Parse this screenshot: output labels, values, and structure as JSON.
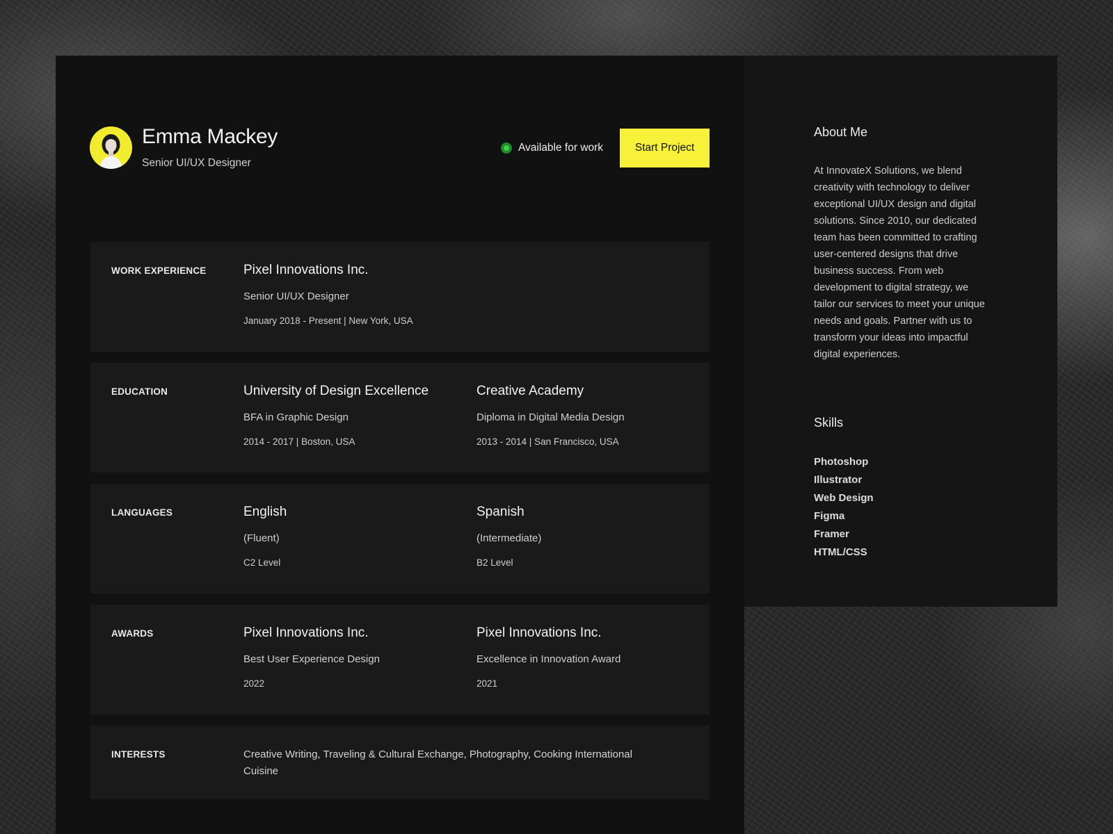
{
  "profile": {
    "name": "Emma Mackey",
    "role": "Senior UI/UX Designer",
    "status": "Available for work",
    "cta_label": "Start Project"
  },
  "sections": {
    "work": {
      "label": "WORK EXPERIENCE",
      "items": [
        {
          "title": "Pixel Innovations Inc.",
          "subtitle": "Senior UI/UX Designer",
          "meta": "January 2018 - Present | New York, USA"
        }
      ]
    },
    "education": {
      "label": "EDUCATION",
      "items": [
        {
          "title": "University of Design Excellence",
          "subtitle": "BFA in Graphic Design",
          "meta": "2014 - 2017 | Boston, USA"
        },
        {
          "title": "Creative Academy",
          "subtitle": "Diploma in Digital Media Design",
          "meta": "2013 - 2014 | San Francisco, USA"
        }
      ]
    },
    "languages": {
      "label": "LANGUAGES",
      "items": [
        {
          "title": "English",
          "subtitle": "(Fluent)",
          "meta": "C2 Level"
        },
        {
          "title": "Spanish",
          "subtitle": "(Intermediate)",
          "meta": "B2 Level"
        }
      ]
    },
    "awards": {
      "label": "AWARDS",
      "items": [
        {
          "title": "Pixel Innovations Inc.",
          "subtitle": "Best User Experience Design",
          "meta": "2022"
        },
        {
          "title": "Pixel Innovations Inc.",
          "subtitle": "Excellence in Innovation Award",
          "meta": "2021"
        }
      ]
    },
    "interests": {
      "label": "INTERESTS",
      "text": "Creative Writing, Traveling & Cultural Exchange, Photography, Cooking International Cuisine"
    }
  },
  "sidebar": {
    "about_title": "About Me",
    "about_text": "At InnovateX Solutions, we blend creativity with technology to deliver exceptional UI/UX design and digital solutions. Since 2010, our dedicated team has been committed to crafting user-centered designs that drive business success. From web development to digital strategy, we tailor our services to meet your unique needs and goals. Partner with us to transform your ideas into impactful digital experiences.",
    "skills_title": "Skills",
    "skills": [
      "Photoshop",
      "Illustrator",
      "Web Design",
      "Figma",
      "Framer",
      "HTML/CSS"
    ]
  },
  "colors": {
    "accent": "#f7f13a",
    "status_dot": "#3fcf48",
    "panel": "#111111",
    "card": "#1a1a1a"
  },
  "icons": {
    "avatar": "person-avatar",
    "status": "status-dot-icon"
  }
}
